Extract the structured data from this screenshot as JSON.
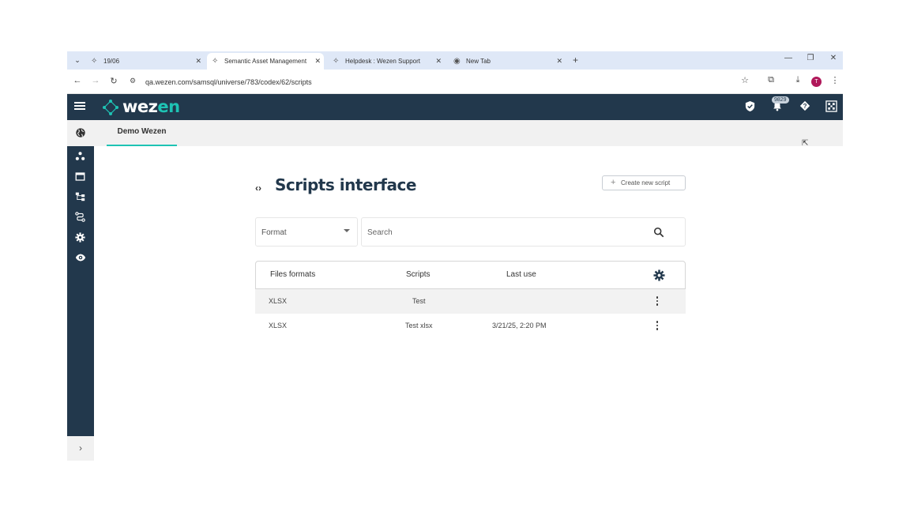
{
  "browser": {
    "tabs": [
      {
        "label": "19/06",
        "active": false
      },
      {
        "label": "Semantic Asset Management",
        "active": true
      },
      {
        "label": "Helpdesk : Wezen Support",
        "active": false
      },
      {
        "label": "New Tab",
        "active": false
      }
    ],
    "url": "qa.wezen.com/samsql/universe/783/codex/62/scripts",
    "profile_initial": "T"
  },
  "app": {
    "logo_text_main": "wez",
    "logo_text_accent": "en",
    "notification_count": "9829"
  },
  "project": {
    "tab_label": "Demo Wezen"
  },
  "page": {
    "title": "Scripts interface",
    "create_button_label": "Create new script",
    "format_placeholder": "Format",
    "search_placeholder": "Search"
  },
  "table": {
    "headers": [
      "Files formats",
      "Scripts",
      "Last use"
    ],
    "rows": [
      {
        "format": "XLSX",
        "script": "Test",
        "last_use": ""
      },
      {
        "format": "XLSX",
        "script": "Test xlsx",
        "last_use": "3/21/25, 2:20 PM"
      }
    ]
  },
  "colors": {
    "header_bg": "#22384c",
    "accent": "#1ec3b4"
  }
}
